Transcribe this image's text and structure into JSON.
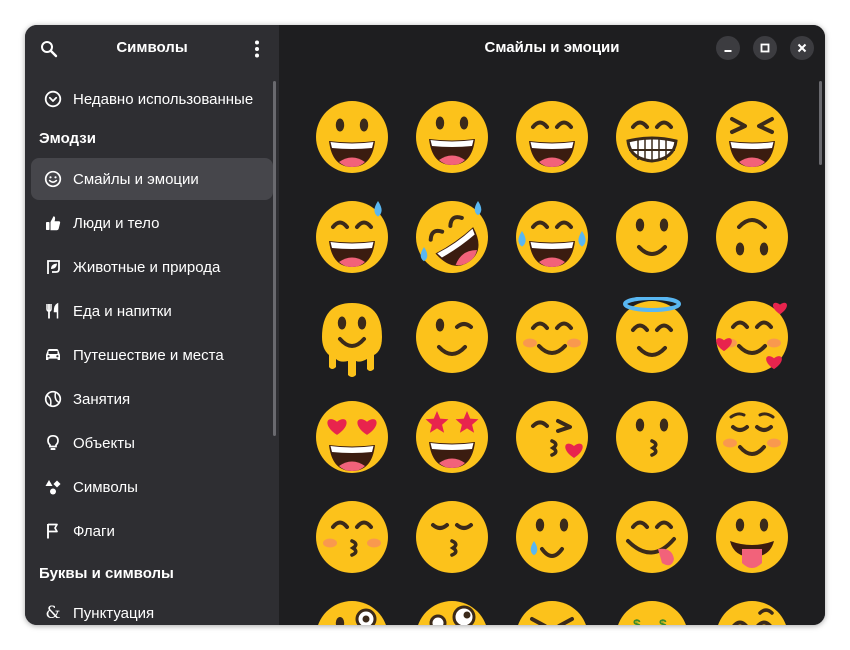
{
  "sidebar": {
    "title": "Символы",
    "recent": "Недавно использованные",
    "sections": {
      "emoji": "Эмодзи",
      "letters": "Буквы и символы"
    },
    "items": [
      {
        "label": "Смайлы и эмоции",
        "icon": "smiley-icon",
        "active": true
      },
      {
        "label": "Люди и тело",
        "icon": "thumbs-up-icon"
      },
      {
        "label": "Животные и природа",
        "icon": "leaf-icon"
      },
      {
        "label": "Еда и напитки",
        "icon": "fork-knife-icon"
      },
      {
        "label": "Путешествие и места",
        "icon": "car-icon"
      },
      {
        "label": "Занятия",
        "icon": "ball-icon"
      },
      {
        "label": "Объекты",
        "icon": "lightbulb-icon"
      },
      {
        "label": "Символы",
        "icon": "shapes-icon"
      },
      {
        "label": "Флаги",
        "icon": "flag-icon"
      }
    ],
    "punctuation": "Пунктуация"
  },
  "main": {
    "title": "Смайлы и эмоции",
    "emojis": [
      "grinning-face",
      "grinning-face-big-eyes",
      "grinning-face-smiling-eyes",
      "beaming-face",
      "grinning-squinting-face",
      "grinning-face-sweat",
      "rolling-on-floor-laughing",
      "face-tears-of-joy",
      "slightly-smiling-face",
      "upside-down-face",
      "melting-face",
      "winking-face",
      "smiling-face-smiling-eyes",
      "smiling-face-halo",
      "smiling-face-hearts",
      "heart-eyes-face",
      "star-struck",
      "face-blowing-kiss",
      "kissing-face",
      "smiling-face",
      "kissing-face-closed-eyes",
      "kissing-face-smiling-eyes",
      "face-holding-back-tears",
      "face-savoring-food",
      "face-with-tongue",
      "winking-face-tongue",
      "zany-face",
      "squinting-face-tongue",
      "money-mouth-face",
      "smiling-face-open-hands"
    ]
  }
}
